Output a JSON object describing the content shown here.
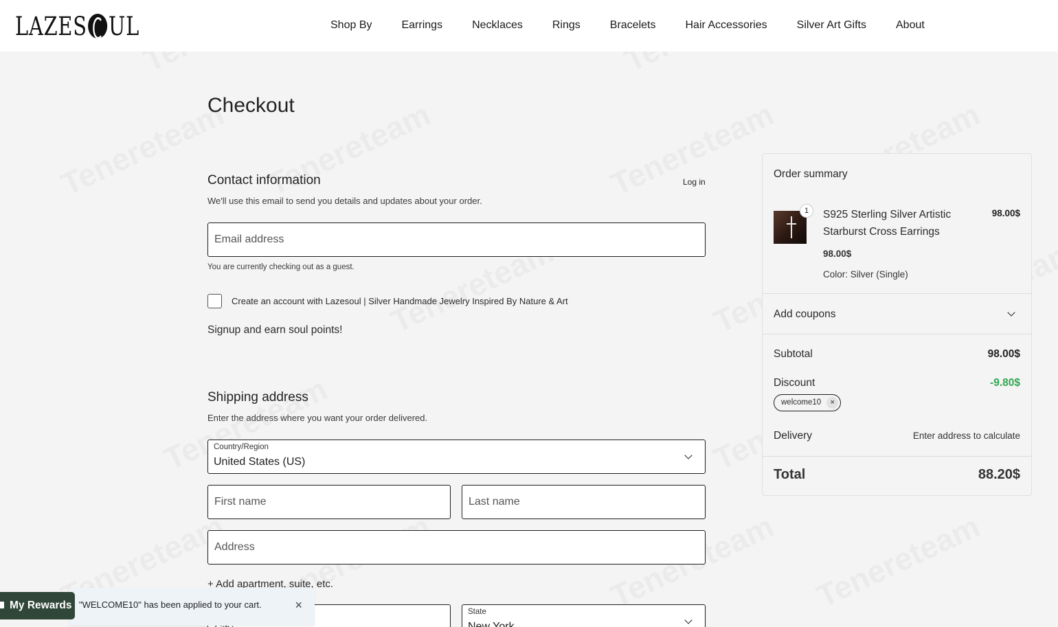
{
  "brand": {
    "name": "LAZESOUL"
  },
  "nav": {
    "items": [
      "Shop By",
      "Earrings",
      "Necklaces",
      "Rings",
      "Bracelets",
      "Hair Accessories",
      "Silver Art Gifts",
      "About"
    ]
  },
  "page": {
    "title": "Checkout"
  },
  "contact": {
    "title": "Contact information",
    "login_label": "Log in",
    "description": "We'll use this email to send you details and updates about your order.",
    "email_placeholder": "Email address",
    "email_value": "",
    "guest_note": "You are currently checking out as a guest.",
    "create_account_label": "Create an account with Lazesoul | Silver Handmade Jewelry Inspired By Nature & Art",
    "create_account_checked": false,
    "signup_text": "Signup and earn soul points!"
  },
  "shipping": {
    "title": "Shipping address",
    "description": "Enter the address where you want your order delivered.",
    "country_label": "Country/Region",
    "country_value": "United States (US)",
    "first_name_placeholder": "First name",
    "last_name_placeholder": "Last name",
    "address_placeholder": "Address",
    "add_apartment_label": "+ Add apartment, suite, etc.",
    "city_placeholder": "City",
    "state_label": "State",
    "state_value": "New York"
  },
  "summary": {
    "title": "Order summary",
    "item": {
      "quantity": "1",
      "name": "S925 Sterling Silver Artistic Starburst Cross Earrings",
      "line_total": "98.00$",
      "unit_price": "98.00$",
      "variant": "Color: Silver (Single)"
    },
    "add_coupons_label": "Add coupons",
    "subtotal_label": "Subtotal",
    "subtotal_value": "98.00$",
    "discount_label": "Discount",
    "discount_value": "-9.80$",
    "coupon_code": "welcome10",
    "delivery_label": "Delivery",
    "delivery_value": "Enter address to calculate",
    "total_label": "Total",
    "total_value": "88.20$"
  },
  "rewards": {
    "label": "My Rewards"
  },
  "toast": {
    "message": "\"WELCOME10\" has been applied to your cart."
  },
  "watermark": {
    "text": "Tenereteam"
  },
  "colors": {
    "background": "#f4f4f4",
    "rewards_bg": "#2f4638",
    "discount_green": "#2fa64f",
    "toast_bg": "#eef3f8"
  }
}
